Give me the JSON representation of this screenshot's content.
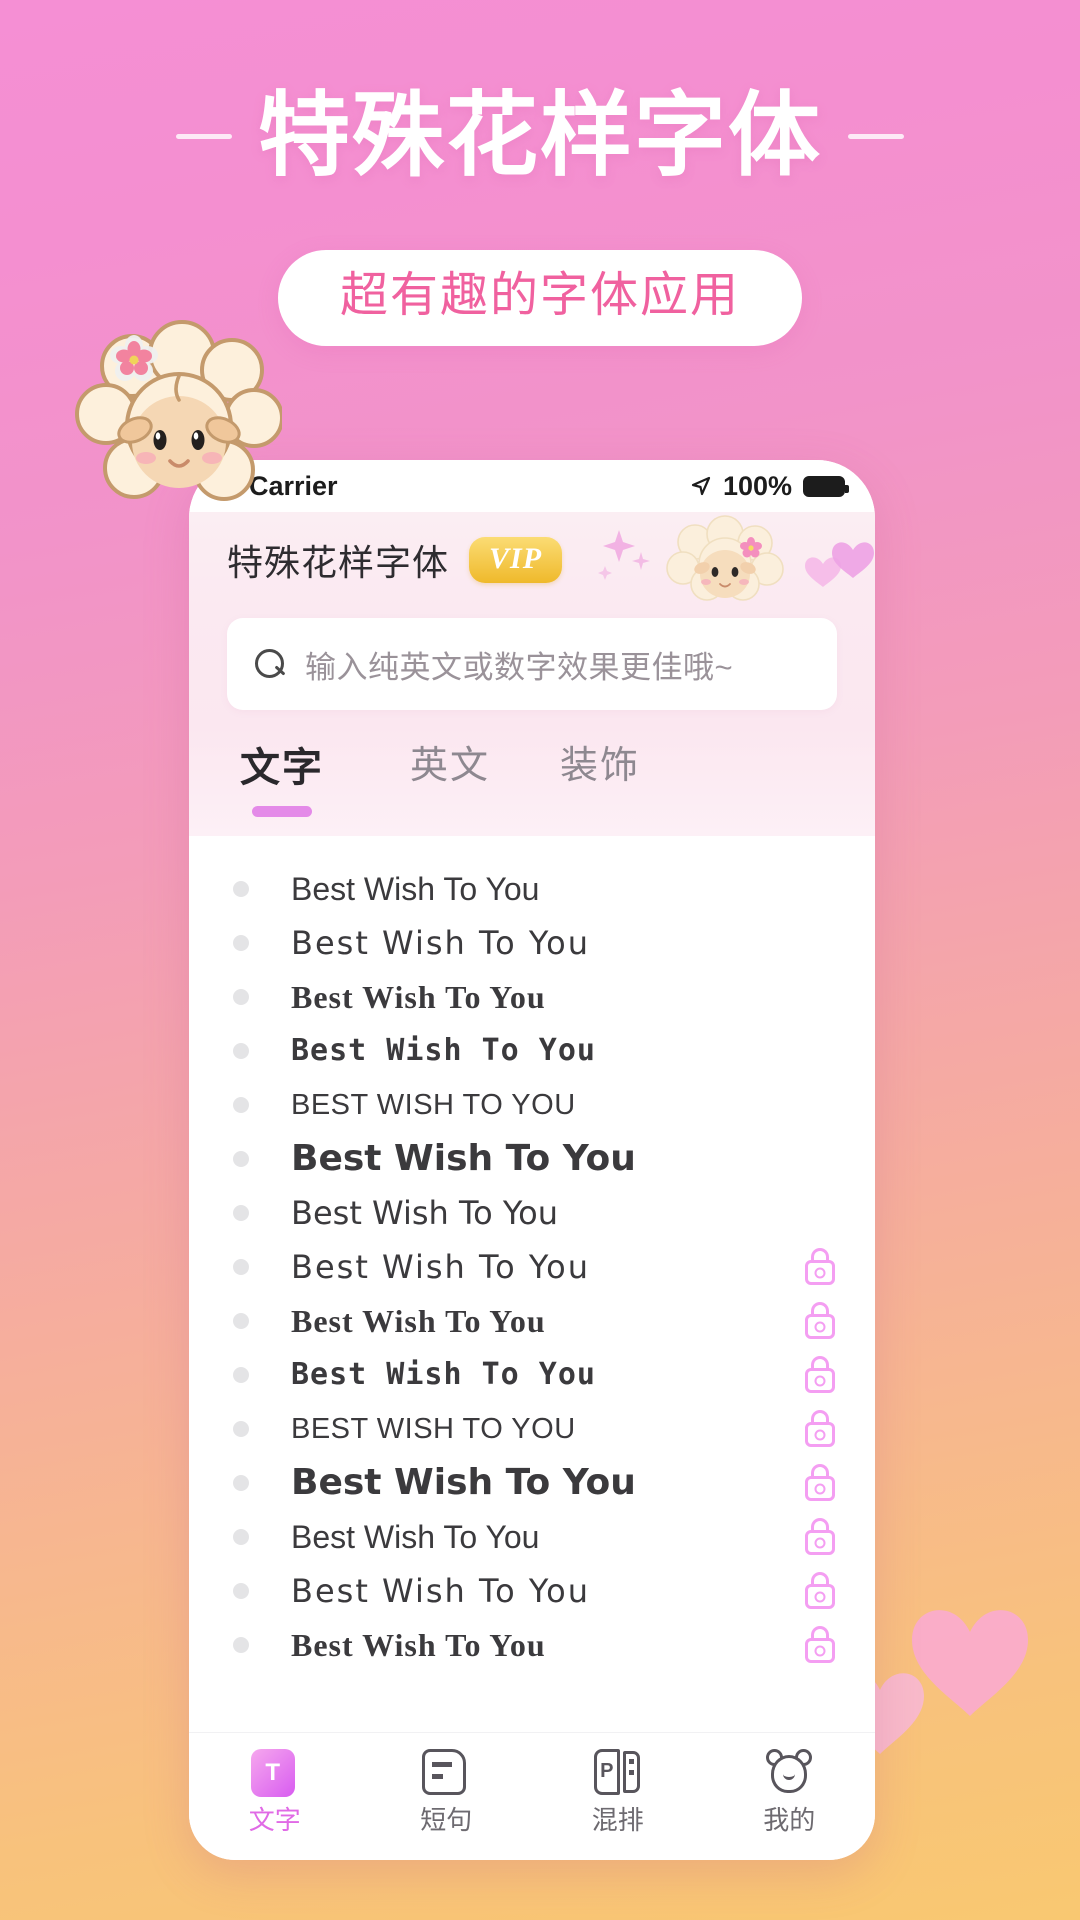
{
  "promo": {
    "title": "特殊花样字体",
    "subtitle": "超有趣的字体应用",
    "title_color": "#ffffff",
    "subtitle_color": "#f0619f",
    "bg_top_color": "#f58fd4",
    "bg_bottom_color": "#f9c871"
  },
  "statusbar": {
    "carrier": "Carrier",
    "battery_percent": "100%",
    "location_icon": "location-arrow-icon",
    "battery_icon": "battery-full-icon",
    "back_icon": "chevron-left-icon"
  },
  "app_header": {
    "title": "特殊花样字体",
    "vip_label": "VIP",
    "vip_color": "#efb92b",
    "sheep_icon": "sheep-icon",
    "sparkle_icon": "sparkle-icon",
    "heart_icon": "heart-icon"
  },
  "search": {
    "placeholder": "输入纯英文或数字效果更佳哦~",
    "icon": "search-icon",
    "value": ""
  },
  "tabs": {
    "active_index": 0,
    "accent_color": "#e48ae8",
    "items": [
      {
        "label": "文字"
      },
      {
        "label": "英文"
      },
      {
        "label": "装饰"
      }
    ]
  },
  "font_list": {
    "sample_text": "Best Wish To You",
    "lock_icon": "lock-icon",
    "lock_color": "#f49ef2",
    "rows": [
      {
        "text": "Best Wish To You",
        "style": "f1",
        "locked": false
      },
      {
        "text": "Best Wish To You",
        "style": "f2",
        "locked": false
      },
      {
        "text": "Best Wish To You",
        "style": "f3",
        "locked": false
      },
      {
        "text": "Best Wish To You",
        "style": "f4",
        "locked": false
      },
      {
        "text": "BEST WISH TO YOU",
        "style": "f5",
        "locked": false
      },
      {
        "text": "Best Wish To You",
        "style": "f6",
        "locked": false
      },
      {
        "text": "Best Wish To You",
        "style": "f7",
        "locked": false
      },
      {
        "text": "Best Wish To You",
        "style": "f2",
        "locked": true
      },
      {
        "text": "Best Wish To You",
        "style": "f3",
        "locked": true
      },
      {
        "text": "Best Wish To You",
        "style": "f4",
        "locked": true
      },
      {
        "text": "BEST WISH TO YOU",
        "style": "f5",
        "locked": true
      },
      {
        "text": "Best Wish To You",
        "style": "f6",
        "locked": true
      },
      {
        "text": "Best Wish To You",
        "style": "f1",
        "locked": true
      },
      {
        "text": "Best Wish To You",
        "style": "f2",
        "locked": true
      },
      {
        "text": "Best Wish To You",
        "style": "f3",
        "locked": true
      }
    ]
  },
  "bottom_nav": {
    "active_index": 0,
    "active_color": "#e06ae6",
    "items": [
      {
        "label": "文字",
        "icon": "text-tool-icon"
      },
      {
        "label": "短句",
        "icon": "phrase-card-icon"
      },
      {
        "label": "混排",
        "icon": "mixed-layout-icon"
      },
      {
        "label": "我的",
        "icon": "profile-bear-icon"
      }
    ]
  },
  "decor": {
    "mascot_icon": "sheep-mascot-icon",
    "hearts_icon": "hearts-icon",
    "flower_icon": "flower-icon"
  }
}
